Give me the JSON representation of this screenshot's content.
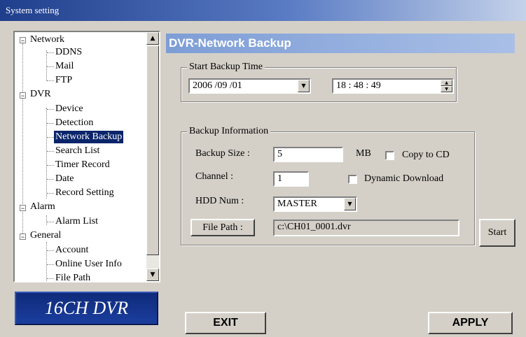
{
  "window": {
    "title": "System setting"
  },
  "tree": {
    "items": [
      {
        "label": "Network",
        "level": 0,
        "expanded": true
      },
      {
        "label": "DDNS",
        "level": 1
      },
      {
        "label": "Mail",
        "level": 1
      },
      {
        "label": "FTP",
        "level": 1
      },
      {
        "label": "DVR",
        "level": 0,
        "expanded": true
      },
      {
        "label": "Device",
        "level": 1
      },
      {
        "label": "Detection",
        "level": 1
      },
      {
        "label": "Network Backup",
        "level": 1,
        "selected": true
      },
      {
        "label": "Search List",
        "level": 1
      },
      {
        "label": "Timer Record",
        "level": 1
      },
      {
        "label": "Date",
        "level": 1
      },
      {
        "label": "Record Setting",
        "level": 1
      },
      {
        "label": "Alarm",
        "level": 0,
        "expanded": true
      },
      {
        "label": "Alarm List",
        "level": 1
      },
      {
        "label": "General",
        "level": 0,
        "expanded": true
      },
      {
        "label": "Account",
        "level": 1
      },
      {
        "label": "Online User Info",
        "level": 1
      },
      {
        "label": "File Path",
        "level": 1
      }
    ]
  },
  "logo": {
    "text": "16CH DVR"
  },
  "panel": {
    "title": "DVR-Network Backup",
    "start_time": {
      "legend": "Start Backup Time",
      "date_value": "2006 /09 /01",
      "time_value": "18 : 48 : 49"
    },
    "backup_info": {
      "legend": "Backup Information",
      "size_label": "Backup Size :",
      "size_value": "5",
      "size_unit": "MB",
      "copy_to_cd_label": "Copy to CD",
      "copy_to_cd_checked": false,
      "channel_label": "Channel :",
      "channel_value": "1",
      "dynamic_download_label": "Dynamic Download",
      "dynamic_download_checked": false,
      "hdd_label": "HDD Num :",
      "hdd_value": "MASTER",
      "file_path_button": "File Path :",
      "file_path_value": "c:\\CH01_0001.dvr"
    },
    "start_button": "Start"
  },
  "footer": {
    "exit_label": "EXIT",
    "apply_label": "APPLY"
  },
  "colors": {
    "selection": "#0a246a",
    "title_gradient_start": "#1f3e8c",
    "panel_title": "#7d9dd6",
    "logo_bg": "#0e2a7a"
  }
}
